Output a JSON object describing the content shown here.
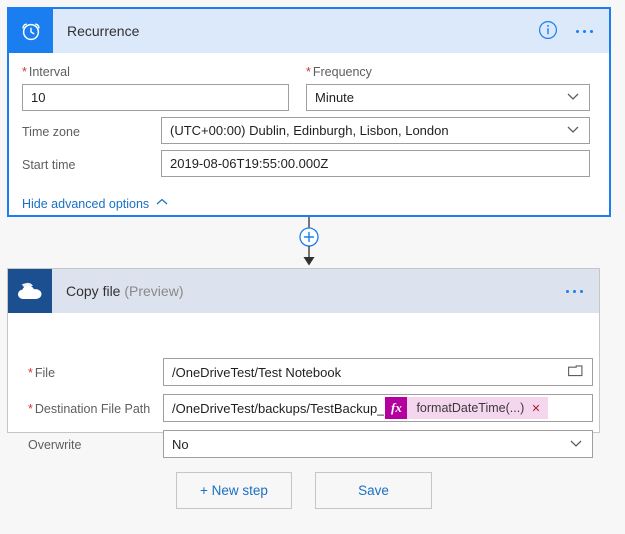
{
  "recurrence": {
    "icon": "alarm-clock-icon",
    "title": "Recurrence",
    "info_icon": "info-icon",
    "more_icon": "more-options-icon",
    "accent_color": "#1a7ef0",
    "header_bg": "#dbe9fb",
    "fields": {
      "interval": {
        "label": "Interval",
        "required": true,
        "value": "10"
      },
      "frequency": {
        "label": "Frequency",
        "required": true,
        "value": "Minute",
        "chevron": "chevron-down-icon"
      },
      "timezone": {
        "label": "Time zone",
        "required": false,
        "value": "(UTC+00:00) Dublin, Edinburgh, Lisbon, London",
        "chevron": "chevron-down-icon"
      },
      "starttime": {
        "label": "Start time",
        "required": false,
        "value": "2019-08-06T19:55:00.000Z"
      }
    },
    "advanced_link": {
      "label": "Hide advanced options",
      "chevron": "chevron-up-icon"
    }
  },
  "connector": {
    "add_icon": "plus-circle-icon",
    "arrow_icon": "arrow-down-icon",
    "accent_color": "#1a7ef0"
  },
  "copyfile": {
    "icon": "onedrive-cloud-icon",
    "title": "Copy file",
    "preview_tag": "(Preview)",
    "more_icon": "more-options-icon",
    "icon_bg": "#1b4f8f",
    "header_bg": "#dce3ef",
    "fields": {
      "file": {
        "label": "File",
        "required": true,
        "value": "/OneDriveTest/Test Notebook",
        "picker_icon": "folder-picker-icon"
      },
      "destination": {
        "label": "Destination File Path",
        "required": true,
        "value": "/OneDriveTest/backups/TestBackup_",
        "token": {
          "fx_label": "fx",
          "text": "formatDateTime(...)",
          "remove_icon": "close-icon",
          "badge_color": "#b4009e",
          "body_color": "#f5d6ef"
        }
      },
      "overwrite": {
        "label": "Overwrite",
        "required": false,
        "value": "No",
        "chevron": "chevron-down-icon"
      }
    }
  },
  "footer": {
    "new_step_label": "+ New step",
    "save_label": "Save"
  }
}
